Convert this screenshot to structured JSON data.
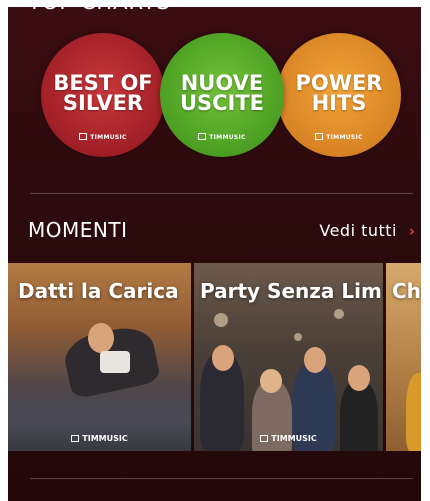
{
  "top_charts": {
    "title": "TOP CHARTS",
    "items": [
      {
        "label": "BEST OF\nSILVER",
        "brand": "TIMMUSIC",
        "color": "#a01f26"
      },
      {
        "label": "NUOVE\nUSCITE",
        "brand": "TIMMUSIC",
        "color": "#4b9e22"
      },
      {
        "label": "POWER\nHITS",
        "brand": "TIMMUSIC",
        "color": "#d88324"
      }
    ]
  },
  "momenti": {
    "title": "MOMENTI",
    "see_all": "Vedi tutti",
    "see_all_icon": "chevron-right-icon",
    "cards": [
      {
        "label": "Datti la Carica",
        "brand": "TIMMUSIC"
      },
      {
        "label": "Party Senza Limiti",
        "brand": "TIMMUSIC"
      },
      {
        "label": "Chi"
      }
    ]
  },
  "colors": {
    "background": "#2c0a0d",
    "accent": "#e23a3a"
  }
}
